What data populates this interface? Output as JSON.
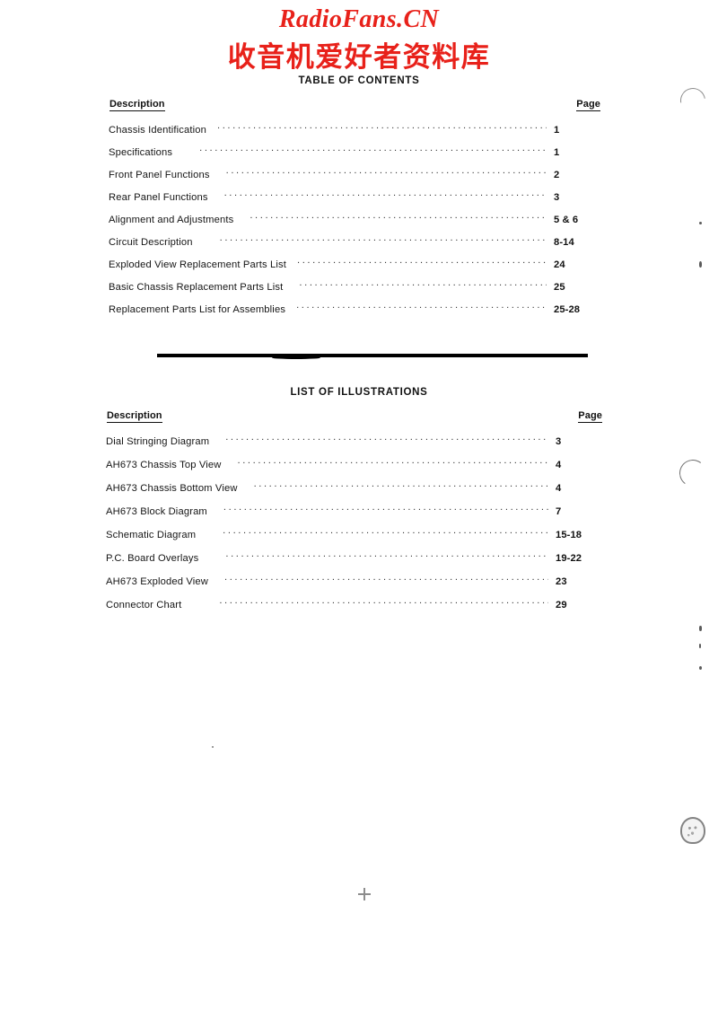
{
  "watermark": {
    "latin": "RadioFans.CN",
    "chinese": "收音机爱好者资料库",
    "color": "#e8211a"
  },
  "table_of_contents": {
    "heading": "TABLE OF CONTENTS",
    "columns": {
      "description": "Description",
      "page": "Page"
    },
    "rows": [
      {
        "label": "Chassis Identification",
        "page": "1"
      },
      {
        "label": "Specifications",
        "page": "1"
      },
      {
        "label": "Front Panel Functions",
        "page": "2"
      },
      {
        "label": "Rear Panel Functions",
        "page": "3"
      },
      {
        "label": "Alignment and Adjustments",
        "page": "5 & 6"
      },
      {
        "label": "Circuit Description",
        "page": "8-14"
      },
      {
        "label": "Exploded View Replacement Parts List",
        "page": "24"
      },
      {
        "label": "Basic Chassis Replacement Parts List",
        "page": "25"
      },
      {
        "label": "Replacement Parts List for Assemblies",
        "page": "25-28"
      }
    ]
  },
  "list_of_illustrations": {
    "heading": "LIST OF ILLUSTRATIONS",
    "columns": {
      "description": "Description",
      "page": "Page"
    },
    "rows": [
      {
        "label": "Dial Stringing Diagram",
        "page": "3"
      },
      {
        "label": "AH673 Chassis Top View",
        "page": "4"
      },
      {
        "label": "AH673 Chassis Bottom View",
        "page": "4"
      },
      {
        "label": "AH673 Block Diagram",
        "page": "7"
      },
      {
        "label": "Schematic Diagram",
        "page": "15-18"
      },
      {
        "label": "P.C. Board Overlays",
        "page": "19-22"
      },
      {
        "label": "AH673 Exploded View",
        "page": "23"
      },
      {
        "label": "Connector Chart",
        "page": "29"
      }
    ]
  }
}
